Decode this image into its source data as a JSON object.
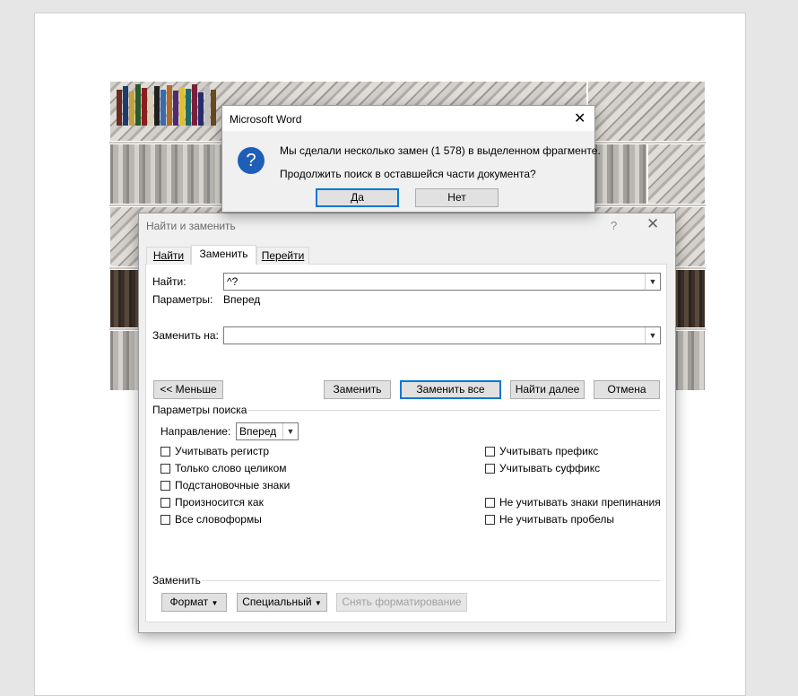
{
  "msgbox": {
    "title": "Microsoft Word",
    "line1": "Мы сделали несколько замен (1 578) в выделенном фрагменте.",
    "line2": "Продолжить поиск в оставшейся части документа?",
    "yes": "Да",
    "no": "Нет",
    "icon": "question-icon"
  },
  "findreplace": {
    "title": "Найти и заменить",
    "help": "?",
    "tabs": [
      "Найти",
      "Заменить",
      "Перейти"
    ],
    "active_tab": "Заменить",
    "find_label": "Найти:",
    "find_value": "^?",
    "params_label": "Параметры:",
    "params_value": "Вперед",
    "replace_label": "Заменить на:",
    "replace_value": "",
    "less_btn": "<< Меньше",
    "replace_btn": "Заменить",
    "replace_all_btn": "Заменить все",
    "find_next_btn": "Найти далее",
    "cancel_btn": "Отмена",
    "search_params_label": "Параметры поиска",
    "direction_label": "Направление:",
    "direction_value": "Вперед",
    "checks_left": [
      "Учитывать регистр",
      "Только слово целиком",
      "Подстановочные знаки",
      "Произносится как",
      "Все словоформы"
    ],
    "checks_right": [
      "Учитывать префикс",
      "Учитывать суффикс",
      "Не учитывать знаки препинания",
      "Не учитывать пробелы"
    ],
    "replace_section_label": "Заменить",
    "format_btn": "Формат",
    "special_btn": "Специальный",
    "clear_format_btn": "Снять форматирование"
  }
}
